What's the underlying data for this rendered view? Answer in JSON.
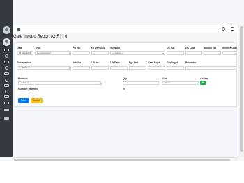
{
  "page": {
    "title": "Gate Inward Report (GIR) - 6"
  },
  "row1": {
    "date_label": "Date",
    "date_value": "21-Sep-2025",
    "type_label": "Type",
    "type_value": "Normal Inward",
    "po_label": "PO No",
    "gi_label": "GI Qty(102)",
    "supplier_label": "Supplier",
    "supplier_value": "--- Select ---",
    "dc_no_label": "DC No",
    "dc_date_label": "DC Date",
    "invoice_no_label": "Invoice No",
    "invoice_date_label": "Invoice Date"
  },
  "row2": {
    "transporter_label": "Transporter",
    "transporter_value": "--- Select ---",
    "veh_label": "Veh No",
    "lr_no_label": "LR No",
    "lr_date_label": "LR Date",
    "fgt_amt_label": "Fgt Amt",
    "kata_rcpt_label": "Kata Rcpt",
    "grs_wght_label": "Grs Wght",
    "remarks_label": "Remarks"
  },
  "items": {
    "product_label": "Product",
    "product_value": "--- Select ---",
    "qty_label": "Qty",
    "unit_label": "Unit",
    "unit_value": "Select",
    "action_label": "Action",
    "add_symbol": "+",
    "number_of_items_label": "Number of Items",
    "number_of_items_value": "0"
  },
  "buttons": {
    "save": "Save",
    "cancel": "Cancel"
  },
  "colors": {
    "sidebar": "#343a40",
    "primary": "#007bff",
    "warning": "#ffc107",
    "success": "#28a745"
  },
  "icons": [
    "menu-icon",
    "search-icon",
    "expand-icon",
    "user-avatar-icon"
  ]
}
